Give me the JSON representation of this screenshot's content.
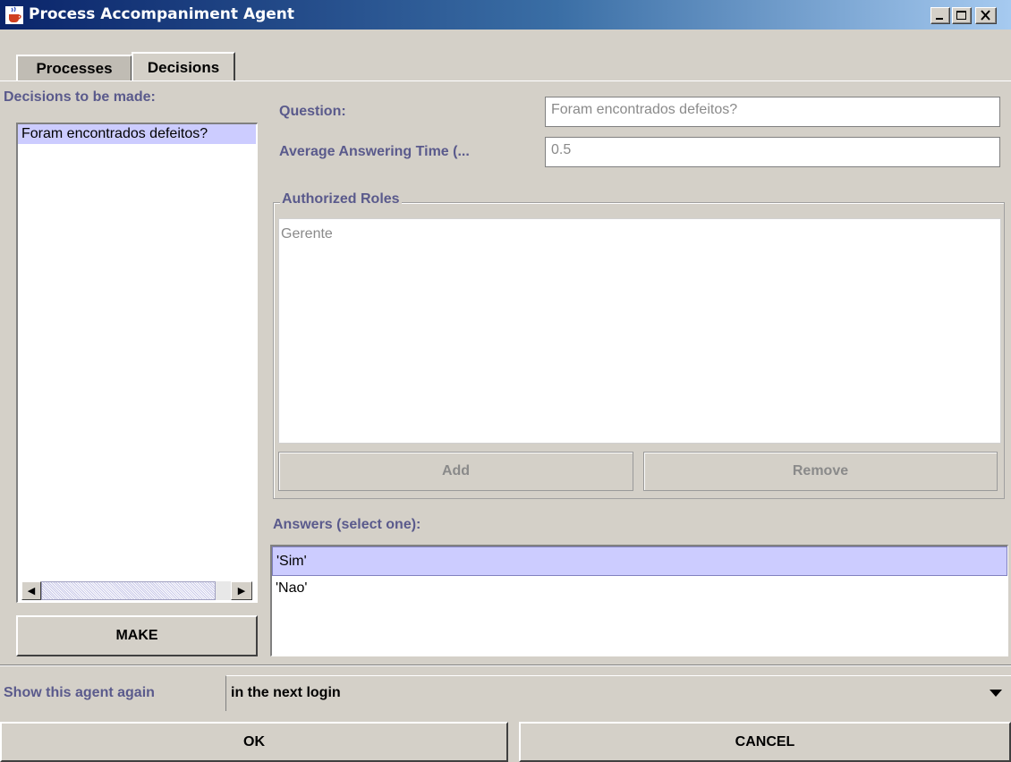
{
  "window": {
    "title": "Process Accompaniment Agent",
    "app_icon": "java-cup-icon"
  },
  "tabs": [
    {
      "label": "Processes",
      "selected": false
    },
    {
      "label": "Decisions",
      "selected": true
    }
  ],
  "decisions_panel": {
    "label": "Decisions to be made:",
    "items": [
      "Foram encontrados defeitos?"
    ],
    "make_label": "MAKE"
  },
  "form": {
    "question_label": "Question:",
    "question_value": "Foram encontrados defeitos?",
    "time_label": "Average Answering Time (...",
    "time_value": "0.5"
  },
  "roles": {
    "legend": "Authorized Roles",
    "items": [
      "Gerente"
    ],
    "add_label": "Add",
    "remove_label": "Remove"
  },
  "answers": {
    "label": "Answers (select one):",
    "items": [
      "'Sim'",
      "'Nao'"
    ],
    "selected_index": 0
  },
  "footer": {
    "show_again_label": "Show this agent again",
    "show_again_value": "in the next login",
    "ok_label": "OK",
    "cancel_label": "CANCEL"
  },
  "colors": {
    "label": "#5a5a8c",
    "selection": "#ccccff",
    "title_start": "#0a246a",
    "title_end": "#a6caf0"
  }
}
